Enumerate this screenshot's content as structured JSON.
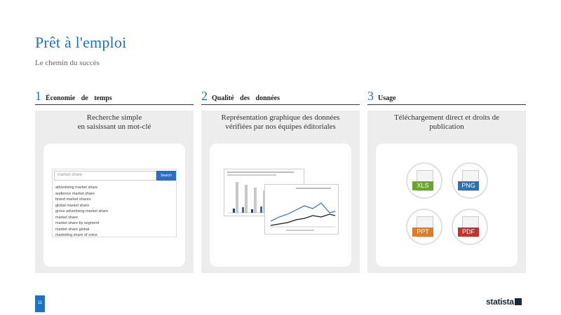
{
  "header": {
    "title": "Prêt à l'emploi",
    "subtitle": "Le chemin du succès"
  },
  "columns": [
    {
      "number": "1",
      "label": "Économie de temps",
      "text_line1": "Recherche simple",
      "text_line2": "en saisissant un mot-clé",
      "search": {
        "placeholder": "market share",
        "button_label": "Search",
        "suggestions": [
          "advertising market share",
          "audience market share",
          "brand market shares",
          "global market share",
          "gross advertising market share",
          "market share",
          "market share by segment",
          "market share global",
          "marketing share of voice"
        ]
      }
    },
    {
      "number": "2",
      "label": "Qualité des données",
      "text_line1": "Représentation graphique des données",
      "text_line2": "vérifiées par nos équipes éditoriales"
    },
    {
      "number": "3",
      "label": "Usage",
      "text_line1": "Téléchargement direct et droits de",
      "text_line2": "publication",
      "formats": [
        "XLS",
        "PNG",
        "PPT",
        "PDF"
      ]
    }
  ],
  "footer": {
    "page_number": "11",
    "brand": "statista"
  },
  "colors": {
    "accent": "#1e73be",
    "panel": "#ededed",
    "xls": "#6aa629",
    "png": "#2f6fb3",
    "ppt": "#e07b24",
    "pdf": "#c8302b"
  }
}
